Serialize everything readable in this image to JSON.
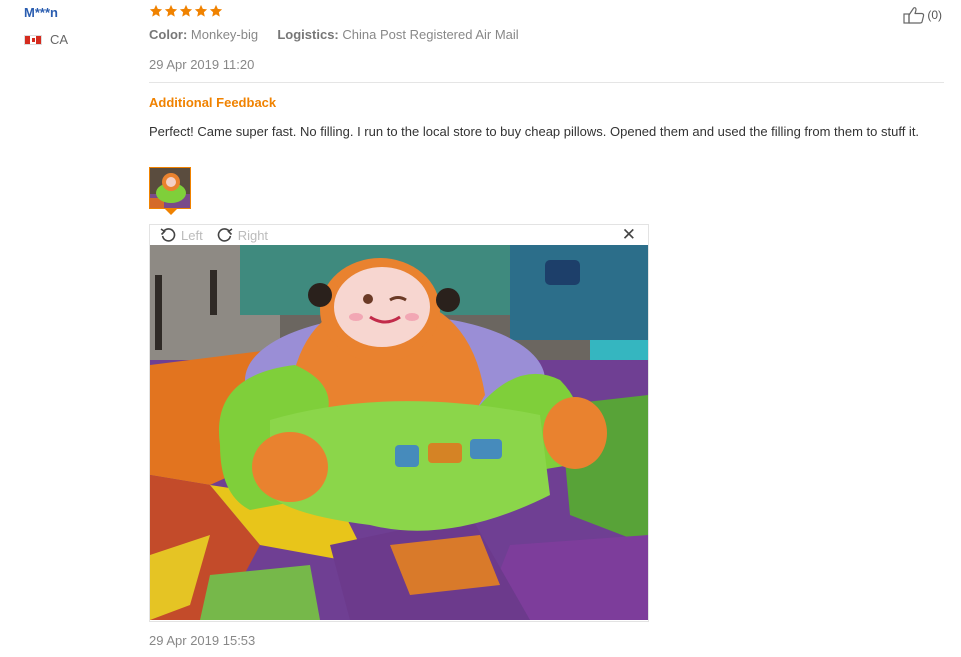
{
  "reviewer": {
    "name": "M***n",
    "country": "CA",
    "flag_icon": "canada-flag-icon"
  },
  "rating": {
    "stars": 5,
    "max": 5,
    "star_color": "#f08200"
  },
  "attributes": {
    "color_label": "Color:",
    "color_value": "Monkey-big",
    "logistics_label": "Logistics:",
    "logistics_value": "China Post Registered Air Mail"
  },
  "review_date": "29 Apr 2019 11:20",
  "helpful": {
    "icon": "thumbs-up-icon",
    "count": "(0)"
  },
  "additional_feedback": {
    "title": "Additional Feedback",
    "text": "Perfect! Came super fast. No filling. I run to the local store to buy cheap pillows. Opened them and used the filling from them to stuff it.",
    "date": "29 Apr 2019 15:53"
  },
  "image_viewer": {
    "rotate_left_label": "Left",
    "rotate_right_label": "Right",
    "close_icon": "close-icon",
    "accent_color": "#f08200"
  }
}
